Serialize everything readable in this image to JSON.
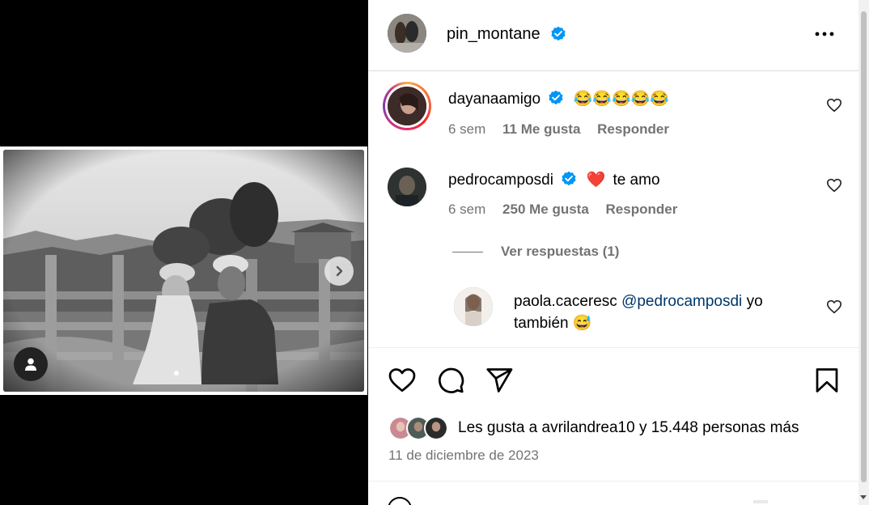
{
  "post": {
    "author": "pin_montane"
  },
  "comments": [
    {
      "user": "dayanaamigo",
      "text": "😂😂😂😂😂",
      "age": "6 sem",
      "likes": "11 Me gusta",
      "reply": "Responder"
    },
    {
      "user": "pedrocamposdi",
      "text": "te amo",
      "emoji": "❤️",
      "age": "6 sem",
      "likes": "250 Me gusta",
      "reply": "Responder"
    }
  ],
  "replies_toggle": "Ver respuestas (1)",
  "reply": {
    "user": "paola.caceresc",
    "mention": "@pedrocamposdi",
    "text_a": "yo",
    "text_b": "también",
    "emoji": "😅"
  },
  "likes_summary": {
    "prefix": "Les gusta a",
    "first_liker": "avrilandrea10",
    "middle": "y",
    "count": "15.448 personas más"
  },
  "date": "11 de diciembre de 2023",
  "icons": [
    "verified-badge-icon",
    "more-options-icon",
    "heart-icon",
    "comment-icon",
    "share-icon",
    "bookmark-icon",
    "chevron-right-icon",
    "user-tag-icon",
    "emoji-icon"
  ],
  "colors": {
    "verified": "#0095f6",
    "secondary_text": "#737373",
    "divider": "#dbdbdb",
    "mention": "#00376b",
    "heart_red": "#e0245e"
  }
}
